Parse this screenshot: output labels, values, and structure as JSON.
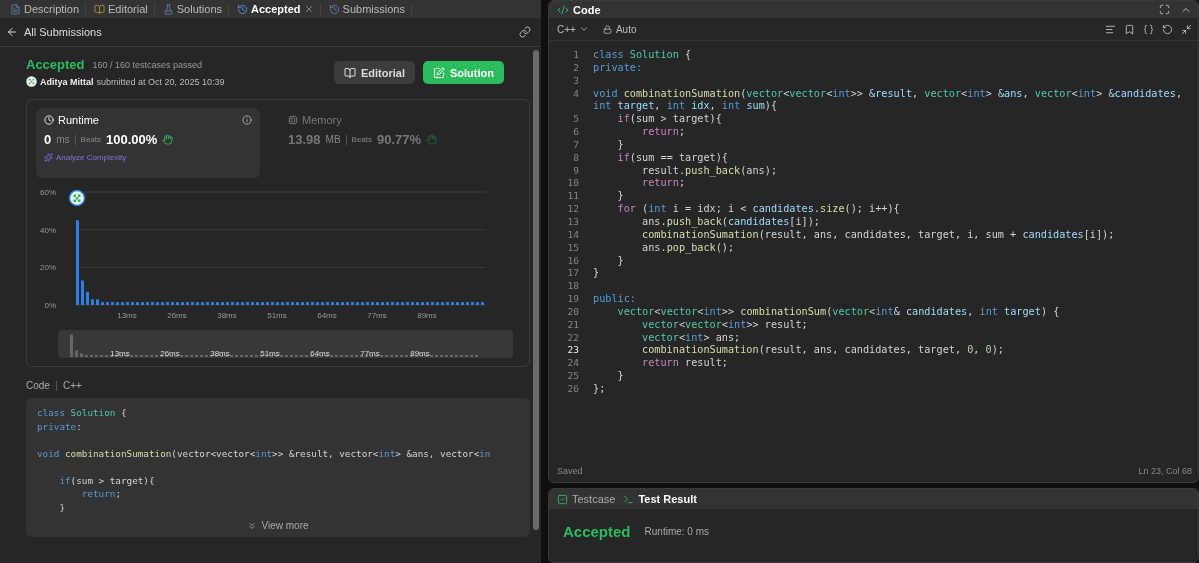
{
  "tabs": [
    {
      "label": "Description",
      "selected": false,
      "closable": false
    },
    {
      "label": "Editorial",
      "selected": false,
      "closable": false
    },
    {
      "label": "Solutions",
      "selected": false,
      "closable": false
    },
    {
      "label": "Accepted",
      "selected": true,
      "closable": true
    },
    {
      "label": "Submissions",
      "selected": false,
      "closable": false
    }
  ],
  "back_link": "All Submissions",
  "result": {
    "status": "Accepted",
    "testcases": "160 / 160 testcases passed",
    "user": "Aditya Mittal",
    "submitted": "submitted at Oct 20, 2025 10:39",
    "buttons": [
      {
        "label": "Editorial",
        "kind": "secondary"
      },
      {
        "label": "Solution",
        "kind": "primary"
      }
    ]
  },
  "stats": [
    {
      "title": "Runtime",
      "selected": true,
      "value": "0",
      "unit": "ms",
      "beats_label": "Beats",
      "beats": "100.00%",
      "action": "Analyze Complexity"
    },
    {
      "title": "Memory",
      "selected": false,
      "value": "13.98",
      "unit": "MB",
      "beats_label": "Beats",
      "beats": "90.77%"
    }
  ],
  "chart_data": {
    "type": "bar",
    "ylim": [
      0,
      60
    ],
    "yticks": [
      {
        "value": 0,
        "label": "0%"
      },
      {
        "value": 20,
        "label": "20%"
      },
      {
        "value": 40,
        "label": "40%"
      },
      {
        "value": 60,
        "label": "60%"
      }
    ],
    "categories": [
      null,
      null,
      null,
      null,
      null,
      null,
      null,
      null,
      null,
      null,
      "13ms",
      null,
      null,
      null,
      null,
      null,
      null,
      null,
      null,
      null,
      "26ms",
      null,
      null,
      null,
      null,
      null,
      null,
      null,
      null,
      null,
      "38ms",
      null,
      null,
      null,
      null,
      null,
      null,
      null,
      null,
      null,
      "51ms",
      null,
      null,
      null,
      null,
      null,
      null,
      null,
      null,
      null,
      "64ms",
      null,
      null,
      null,
      null,
      null,
      null,
      null,
      null,
      null,
      "77ms",
      null,
      null,
      null,
      null,
      null,
      null,
      null,
      null,
      null,
      "89ms",
      null,
      null,
      null,
      null,
      null,
      null,
      null,
      null,
      null,
      null,
      null
    ],
    "series": [
      {
        "color": "#2f7fe8",
        "values": [
          45,
          13,
          7,
          3,
          3,
          1.5,
          1.5,
          1.5,
          1.5,
          1.5,
          1.5,
          1.5,
          1.5,
          1.5,
          1.5,
          1.5,
          1.5,
          1.5,
          1.5,
          1.5,
          1.5,
          1.5,
          1.5,
          1.5,
          1.5,
          1.5,
          1.5,
          1.5,
          1.5,
          1.5,
          1.5,
          1.5,
          1.5,
          1.5,
          1.5,
          1.5,
          1.5,
          1.5,
          1.5,
          1.5,
          1.5,
          1.5,
          1.5,
          1.5,
          1.5,
          1.5,
          1.5,
          1.5,
          1.5,
          1.5,
          1.5,
          1.5,
          1.5,
          1.5,
          1.5,
          1.5,
          1.5,
          1.5,
          1.5,
          1.5,
          1.5,
          1.5,
          1.5,
          1.5,
          1.5,
          1.5,
          1.5,
          1.5,
          1.5,
          1.5,
          1.5,
          1.5,
          1.5,
          1.5,
          1.5,
          1.5,
          1.5,
          1.5,
          1.5,
          1.5,
          1.5,
          1.5
        ]
      }
    ]
  },
  "overview": {
    "labels": [
      "13ms",
      "26ms",
      "38ms",
      "51ms",
      "64ms",
      "77ms",
      "89ms"
    ]
  },
  "snippet": {
    "title": "Code",
    "language": "C++",
    "more": "View more",
    "lines": [
      {
        "kind": "code",
        "tokens": [
          {
            "text": "class",
            "kind": "kw"
          },
          {
            "text": " Solution",
            "kind": "type"
          },
          {
            "text": " {",
            "kind": "plain"
          }
        ]
      },
      {
        "kind": "code",
        "tokens": [
          {
            "text": "private",
            "kind": "kw"
          },
          {
            "text": ":",
            "kind": "plain"
          }
        ]
      },
      {
        "kind": "blank"
      },
      {
        "kind": "code",
        "tokens": [
          {
            "text": "void",
            "kind": "kw"
          },
          {
            "text": " combinationSumation",
            "kind": "fn"
          },
          {
            "text": "(vector<vector<",
            "kind": "plain"
          },
          {
            "text": "int",
            "kind": "kw"
          },
          {
            "text": ">> &result, vector<",
            "kind": "plain"
          },
          {
            "text": "int",
            "kind": "kw"
          },
          {
            "text": "> &ans, vector<",
            "kind": "plain"
          },
          {
            "text": "in",
            "kind": "kw"
          }
        ]
      },
      {
        "kind": "blank"
      },
      {
        "kind": "code",
        "tokens": [
          {
            "text": "    if",
            "kind": "kw"
          },
          {
            "text": "(sum > target){",
            "kind": "plain"
          }
        ]
      },
      {
        "kind": "code",
        "tokens": [
          {
            "text": "        return",
            "kind": "kw"
          },
          {
            "text": ";",
            "kind": "plain"
          }
        ]
      },
      {
        "kind": "code",
        "tokens": [
          {
            "text": "    }",
            "kind": "plain"
          }
        ]
      }
    ]
  },
  "editor": {
    "title": "Code",
    "language": "C++",
    "mode": "Auto",
    "status": "Saved",
    "cursor": "Ln 23, Col 68",
    "lines": [
      {
        "number": "1",
        "current": false,
        "tokens": [
          {
            "text": "class",
            "kind": "kw"
          },
          {
            "text": " Solution",
            "kind": "type"
          },
          {
            "text": " {",
            "kind": "plain"
          }
        ]
      },
      {
        "number": "2",
        "current": false,
        "tokens": [
          {
            "text": "private:",
            "kind": "kw"
          }
        ]
      },
      {
        "number": "3",
        "current": false
      },
      {
        "number": "4",
        "current": false,
        "tokens": [
          {
            "text": "void",
            "kind": "kw"
          },
          {
            "text": " combinationSumation",
            "kind": "fn"
          },
          {
            "text": "(",
            "kind": "plain"
          },
          {
            "text": "vector",
            "kind": "type"
          },
          {
            "text": "<",
            "kind": "plain"
          },
          {
            "text": "vector",
            "kind": "type"
          },
          {
            "text": "<",
            "kind": "plain"
          },
          {
            "text": "int",
            "kind": "kw"
          },
          {
            "text": ">> ",
            "kind": "plain"
          },
          {
            "text": "&result",
            "kind": "var"
          },
          {
            "text": ", ",
            "kind": "plain"
          },
          {
            "text": "vector",
            "kind": "type"
          },
          {
            "text": "<",
            "kind": "plain"
          },
          {
            "text": "int",
            "kind": "kw"
          },
          {
            "text": "> ",
            "kind": "plain"
          },
          {
            "text": "&ans",
            "kind": "var"
          },
          {
            "text": ", ",
            "kind": "plain"
          },
          {
            "text": "vector",
            "kind": "type"
          },
          {
            "text": "<",
            "kind": "plain"
          },
          {
            "text": "int",
            "kind": "kw"
          },
          {
            "text": "> ",
            "kind": "plain"
          },
          {
            "text": "&candidates",
            "kind": "var"
          },
          {
            "text": ", ",
            "kind": "plain"
          },
          {
            "text": "int",
            "kind": "kw"
          },
          {
            "text": " target",
            "kind": "var"
          },
          {
            "text": ", ",
            "kind": "plain"
          },
          {
            "text": "int",
            "kind": "kw"
          },
          {
            "text": " idx",
            "kind": "var"
          },
          {
            "text": ", ",
            "kind": "plain"
          },
          {
            "text": "int",
            "kind": "kw"
          },
          {
            "text": " sum",
            "kind": "var"
          },
          {
            "text": "){",
            "kind": "plain"
          }
        ]
      },
      {
        "number": "5",
        "current": false,
        "tokens": [
          {
            "text": "    if",
            "kind": "ctl"
          },
          {
            "text": "(sum > target){",
            "kind": "plain"
          }
        ]
      },
      {
        "number": "6",
        "current": false,
        "tokens": [
          {
            "text": "        return",
            "kind": "ctl"
          },
          {
            "text": ";",
            "kind": "plain"
          }
        ]
      },
      {
        "number": "7",
        "current": false,
        "tokens": [
          {
            "text": "    }",
            "kind": "plain"
          }
        ]
      },
      {
        "number": "8",
        "current": false,
        "tokens": [
          {
            "text": "    if",
            "kind": "ctl"
          },
          {
            "text": "(sum == target){",
            "kind": "plain"
          }
        ]
      },
      {
        "number": "9",
        "current": false,
        "tokens": [
          {
            "text": "        result.",
            "kind": "plain"
          },
          {
            "text": "push_back",
            "kind": "fn"
          },
          {
            "text": "(ans);",
            "kind": "plain"
          }
        ]
      },
      {
        "number": "10",
        "current": false,
        "tokens": [
          {
            "text": "        return",
            "kind": "ctl"
          },
          {
            "text": ";",
            "kind": "plain"
          }
        ]
      },
      {
        "number": "11",
        "current": false,
        "tokens": [
          {
            "text": "    }",
            "kind": "plain"
          }
        ]
      },
      {
        "number": "12",
        "current": false,
        "tokens": [
          {
            "text": "    for",
            "kind": "ctl"
          },
          {
            "text": " (",
            "kind": "plain"
          },
          {
            "text": "int",
            "kind": "kw"
          },
          {
            "text": " i = idx; i < ",
            "kind": "plain"
          },
          {
            "text": "candidates",
            "kind": "var"
          },
          {
            "text": ".",
            "kind": "plain"
          },
          {
            "text": "size",
            "kind": "fn"
          },
          {
            "text": "(); i++){",
            "kind": "plain"
          }
        ]
      },
      {
        "number": "13",
        "current": false,
        "tokens": [
          {
            "text": "        ans.",
            "kind": "plain"
          },
          {
            "text": "push_back",
            "kind": "fn"
          },
          {
            "text": "(",
            "kind": "plain"
          },
          {
            "text": "candidates",
            "kind": "var"
          },
          {
            "text": "[i]);",
            "kind": "plain"
          }
        ]
      },
      {
        "number": "14",
        "current": false,
        "tokens": [
          {
            "text": "        combinationSumation",
            "kind": "fn"
          },
          {
            "text": "(result, ans, candidates, target, i, sum + ",
            "kind": "plain"
          },
          {
            "text": "candidates",
            "kind": "var"
          },
          {
            "text": "[i]);",
            "kind": "plain"
          }
        ]
      },
      {
        "number": "15",
        "current": false,
        "tokens": [
          {
            "text": "        ans.",
            "kind": "plain"
          },
          {
            "text": "pop_back",
            "kind": "fn"
          },
          {
            "text": "();",
            "kind": "plain"
          }
        ]
      },
      {
        "number": "16",
        "current": false,
        "tokens": [
          {
            "text": "    }",
            "kind": "plain"
          }
        ]
      },
      {
        "number": "17",
        "current": false,
        "tokens": [
          {
            "text": "}",
            "kind": "plain"
          }
        ]
      },
      {
        "number": "18",
        "current": false
      },
      {
        "number": "19",
        "current": false,
        "tokens": [
          {
            "text": "public:",
            "kind": "kw"
          }
        ]
      },
      {
        "number": "20",
        "current": false,
        "tokens": [
          {
            "text": "    vector",
            "kind": "type"
          },
          {
            "text": "<",
            "kind": "plain"
          },
          {
            "text": "vector",
            "kind": "type"
          },
          {
            "text": "<",
            "kind": "plain"
          },
          {
            "text": "int",
            "kind": "kw"
          },
          {
            "text": ">> ",
            "kind": "plain"
          },
          {
            "text": "combinationSum",
            "kind": "fn"
          },
          {
            "text": "(",
            "kind": "plain"
          },
          {
            "text": "vector",
            "kind": "type"
          },
          {
            "text": "<",
            "kind": "plain"
          },
          {
            "text": "int",
            "kind": "kw"
          },
          {
            "text": "& ",
            "kind": "plain"
          },
          {
            "text": "candidates",
            "kind": "var"
          },
          {
            "text": ", ",
            "kind": "plain"
          },
          {
            "text": "int",
            "kind": "kw"
          },
          {
            "text": " target",
            "kind": "var"
          },
          {
            "text": ") {",
            "kind": "plain"
          }
        ]
      },
      {
        "number": "21",
        "current": false,
        "tokens": [
          {
            "text": "        vector",
            "kind": "type"
          },
          {
            "text": "<",
            "kind": "plain"
          },
          {
            "text": "vector",
            "kind": "type"
          },
          {
            "text": "<",
            "kind": "plain"
          },
          {
            "text": "int",
            "kind": "kw"
          },
          {
            "text": ">> result;",
            "kind": "plain"
          }
        ]
      },
      {
        "number": "22",
        "current": false,
        "tokens": [
          {
            "text": "        vector",
            "kind": "type"
          },
          {
            "text": "<",
            "kind": "plain"
          },
          {
            "text": "int",
            "kind": "kw"
          },
          {
            "text": "> ans;",
            "kind": "plain"
          }
        ]
      },
      {
        "number": "23",
        "current": true,
        "tokens": [
          {
            "text": "        combinationSumation",
            "kind": "fn"
          },
          {
            "text": "(result, ans, candidates, target, ",
            "kind": "plain"
          },
          {
            "text": "0",
            "kind": "num"
          },
          {
            "text": ", ",
            "kind": "plain"
          },
          {
            "text": "0",
            "kind": "num"
          },
          {
            "text": ");",
            "kind": "plain"
          }
        ]
      },
      {
        "number": "24",
        "current": false,
        "tokens": [
          {
            "text": "        return",
            "kind": "ctl"
          },
          {
            "text": " result;",
            "kind": "plain"
          }
        ]
      },
      {
        "number": "25",
        "current": false,
        "tokens": [
          {
            "text": "    }",
            "kind": "plain"
          }
        ]
      },
      {
        "number": "26",
        "current": false,
        "tokens": [
          {
            "text": "};",
            "kind": "plain"
          }
        ]
      }
    ]
  },
  "test_panel": {
    "tabs": [
      {
        "label": "Testcase",
        "selected": false
      },
      {
        "label": "Test Result",
        "selected": true
      }
    ],
    "status": "Accepted",
    "runtime": "Runtime: 0 ms"
  }
}
